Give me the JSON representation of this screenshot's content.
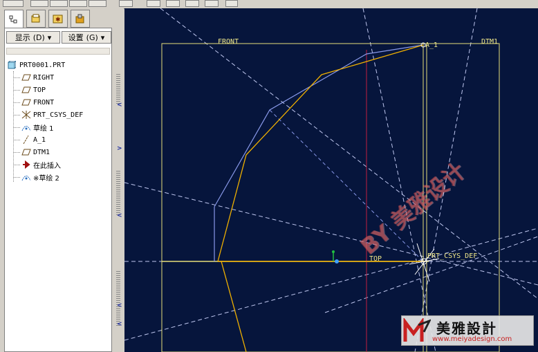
{
  "toolbar": {
    "icons": [
      "navigator-icon",
      "view-icon",
      "view-icon",
      "view-icon",
      "view-icon",
      "view-icon",
      "zoom-icon",
      "spin-icon",
      "orient-icon"
    ]
  },
  "navigator": {
    "tabs": [
      "model-tree-icon",
      "folder-browser-icon",
      "favorites-icon",
      "connections-icon"
    ],
    "show_label": "显示",
    "show_key": "(D)",
    "settings_label": "设置",
    "settings_key": "(G)",
    "tree": {
      "root": "PRT0001.PRT",
      "items": [
        {
          "label": "RIGHT",
          "icon": "datum-plane-icon"
        },
        {
          "label": "TOP",
          "icon": "datum-plane-icon"
        },
        {
          "label": "FRONT",
          "icon": "datum-plane-icon"
        },
        {
          "label": "PRT_CSYS_DEF",
          "icon": "coordinate-system-icon"
        },
        {
          "label": "草绘 1",
          "icon": "sketch-icon"
        },
        {
          "label": "A_1",
          "icon": "datum-axis-icon"
        },
        {
          "label": "DTM1",
          "icon": "datum-plane-icon"
        },
        {
          "label": "在此插入",
          "icon": "insert-here-arrow-icon"
        },
        {
          "label": "※草绘 2",
          "icon": "sketch-icon"
        }
      ]
    }
  },
  "canvas": {
    "labels": {
      "front": "FRONT",
      "dtm1": "DTM1",
      "axis": "A_1",
      "top": "TOP",
      "csys": "PRT_CSYS_DEF"
    },
    "colors": {
      "background": "#06153c",
      "datum": "#e8e07a",
      "sketch": "#f0b000",
      "construction": "#8898e8",
      "center_line": "#a0a8ff",
      "axis_red": "#c02040",
      "dashed": "#c0c8f0"
    }
  },
  "watermark": {
    "diagonal_text": "BY 美雅设计",
    "logo_cn": "美雅設計",
    "logo_url": "www.meiyadesign.com"
  }
}
